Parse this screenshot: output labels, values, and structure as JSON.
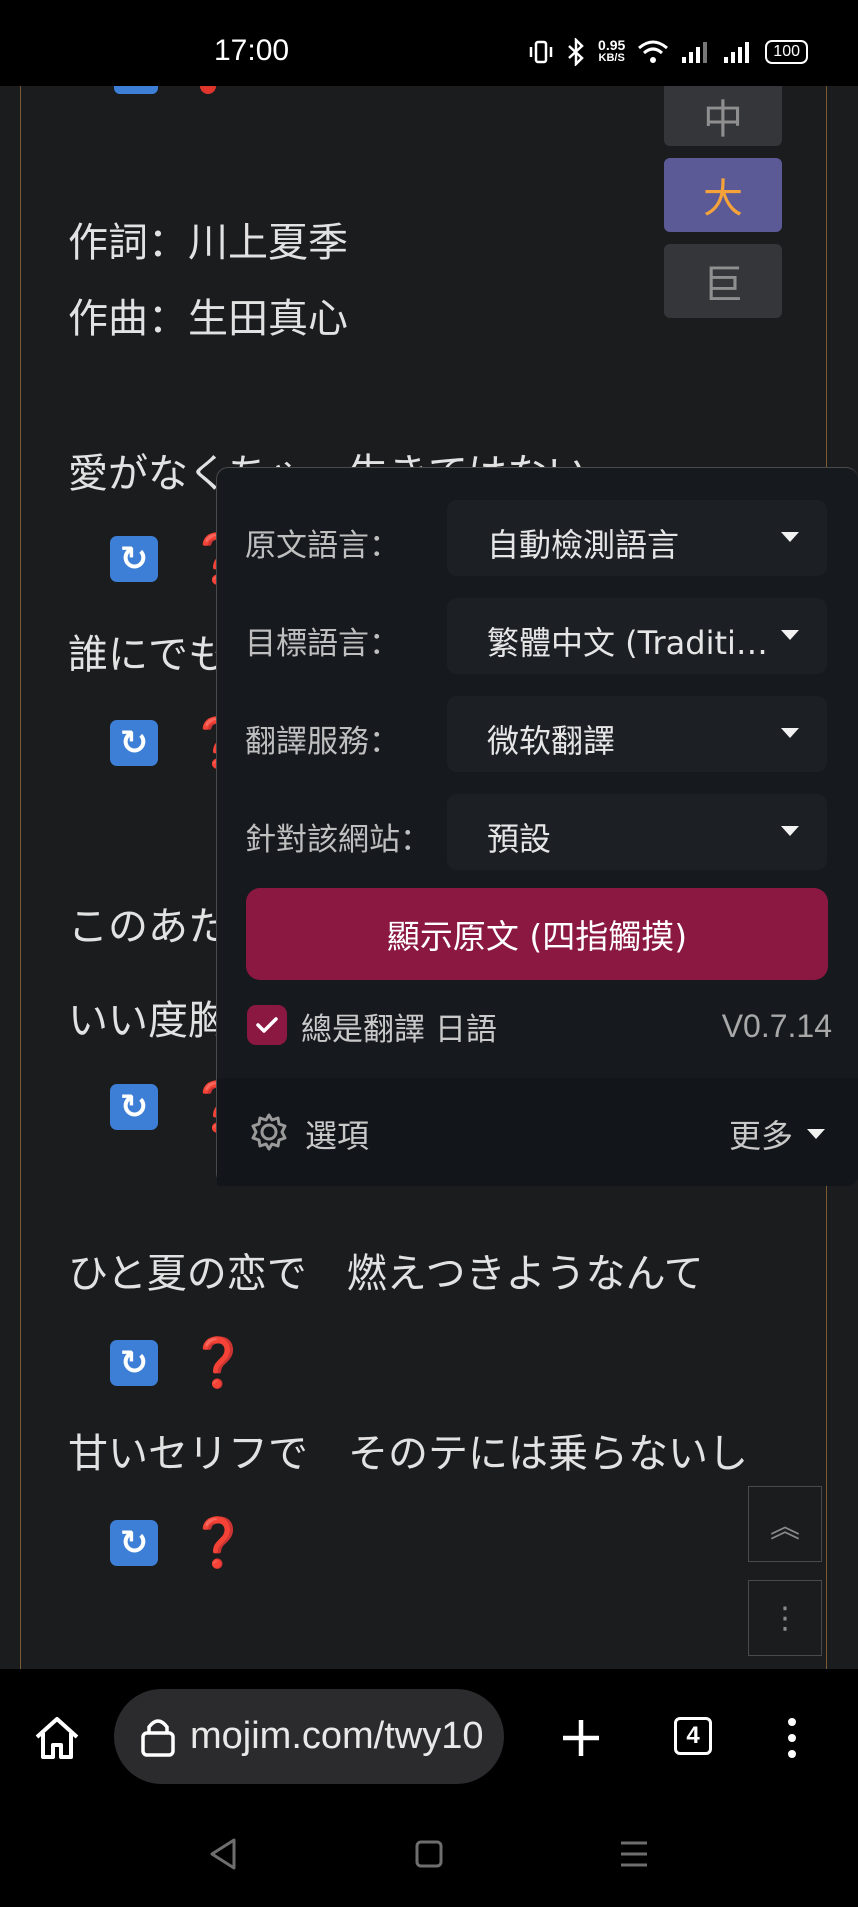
{
  "status_bar": {
    "time": "17:00",
    "net_speed_value": "0.95",
    "net_speed_unit": "KB/S",
    "battery": "100"
  },
  "font_size_buttons": [
    {
      "label": "中",
      "active": false
    },
    {
      "label": "大",
      "active": true
    },
    {
      "label": "巨",
      "active": false
    }
  ],
  "lyrics": {
    "lyricist": "作詞：川上夏季",
    "composer": "作曲：生田真心",
    "line1": "愛がなくちゃ　生きてはない",
    "line2": "誰にでも",
    "line3": "このあた",
    "line4": "いい度胸",
    "line5": "ひと夏の恋で　燃えつきようなんて",
    "line6": "甘いセリフで　そのテには乗らないし",
    "reload_icon": "↻",
    "question_icon": "❓"
  },
  "translate_panel": {
    "source_label": "原文語言：",
    "source_value": "自動檢測語言",
    "target_label": "目標語言：",
    "target_value": "繁體中文 (Traditi…",
    "service_label": "翻譯服務：",
    "service_value": "微软翻譯",
    "site_label": "針對該網站：",
    "site_value": "預設",
    "show_original_button": "顯示原文 (四指觸摸)",
    "always_translate_label": "總是翻譯 日語",
    "always_translate_checked": true,
    "version": "V0.7.14",
    "options_label": "選項",
    "more_label": "更多"
  },
  "side_buttons": {
    "top_icon": "︽",
    "menu_icon": "⋮"
  },
  "browser": {
    "url": "mojim.com/twy10",
    "tab_count": "4"
  },
  "colors": {
    "accent": "#8b1840",
    "active_size_bg": "#5c5a96",
    "active_size_text": "#f5a23a",
    "reload_blue": "#3d7fd6",
    "question_red": "#e0352d"
  }
}
